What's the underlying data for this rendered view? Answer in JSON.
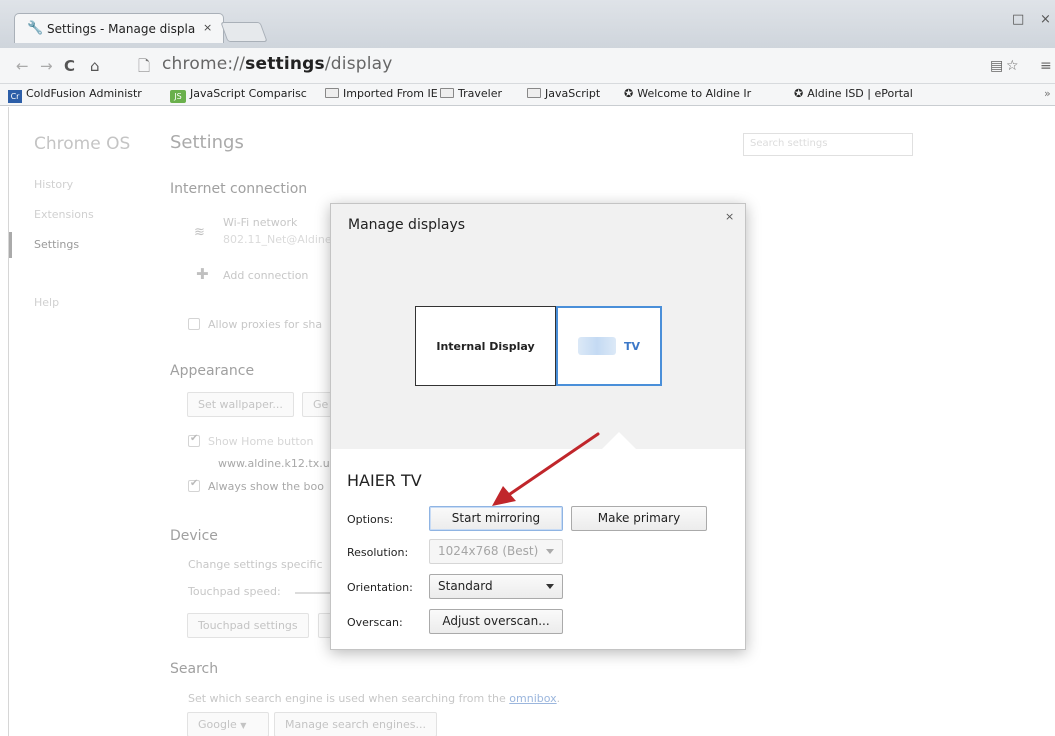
{
  "browser": {
    "tab_title": "Settings - Manage displa",
    "tab_close": "×",
    "url_prefix": "chrome://",
    "url_bold": "settings",
    "url_suffix": "/display",
    "window_minimize": "□",
    "window_close": "×"
  },
  "bookmarks": [
    {
      "label": "ColdFusion Administr",
      "icon": "Cr"
    },
    {
      "label": "JavaScript Comparisc",
      "icon": "JS"
    },
    {
      "label": "Imported From IE"
    },
    {
      "label": "Traveler"
    },
    {
      "label": "JavaScript"
    },
    {
      "label": "Welcome to Aldine Ir"
    },
    {
      "label": "Aldine ISD | ePortal"
    }
  ],
  "bookmarks_overflow": "»",
  "sidebar": {
    "title": "Chrome OS",
    "items": [
      "History",
      "Extensions",
      "Settings",
      "Help"
    ]
  },
  "settings": {
    "title": "Settings",
    "search_placeholder": "Search settings",
    "internet_heading": "Internet connection",
    "wifi_label": "Wi-Fi network",
    "wifi_name": "802.11_Net@Aldine",
    "add_connection": "Add connection",
    "allow_proxies": "Allow proxies for sha",
    "appearance_heading": "Appearance",
    "set_wallpaper": "Set wallpaper...",
    "get_themes": "Ge",
    "show_home": "Show Home button",
    "home_url": "www.aldine.k12.tx.u",
    "always_show": "Always show the boo",
    "device_heading": "Device",
    "device_desc": "Change settings specific",
    "touchpad_speed": "Touchpad speed:",
    "touchpad_settings": "Touchpad settings",
    "search_heading": "Search",
    "search_desc_prefix": "Set which search engine is used when searching from the ",
    "search_desc_link": "omnibox",
    "search_desc_suffix": ".",
    "search_engine": "Google",
    "manage_engines": "Manage search engines..."
  },
  "dialog": {
    "title": "Manage displays",
    "close": "×",
    "internal_display": "Internal Display",
    "tv_display": "TV",
    "display_name": "HAIER TV",
    "options_label": "Options:",
    "start_mirroring": "Start mirroring",
    "make_primary": "Make primary",
    "resolution_label": "Resolution:",
    "resolution_value": "1024x768 (Best)",
    "orientation_label": "Orientation:",
    "orientation_value": "Standard",
    "overscan_label": "Overscan:",
    "adjust_overscan": "Adjust overscan..."
  },
  "colors": {
    "selected_display_border": "#4a8fd9",
    "arrow": "#c0262b"
  }
}
